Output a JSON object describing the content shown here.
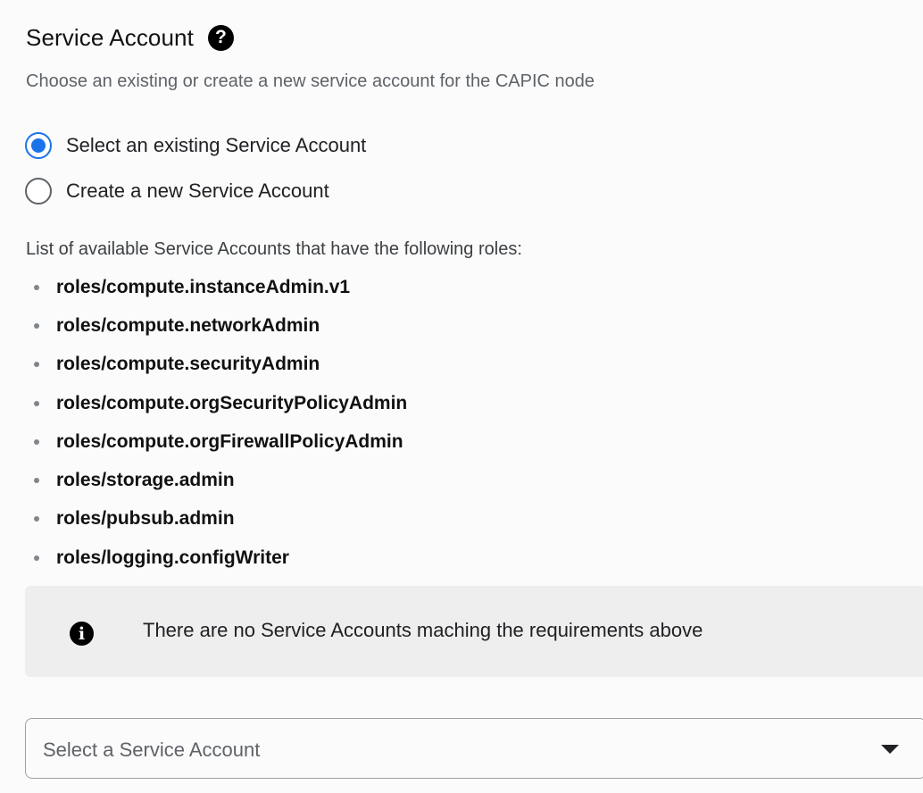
{
  "header": {
    "title": "Service Account",
    "help_icon": "question-circle-icon",
    "subtitle": "Choose an existing or create a new service account for the CAPIC node"
  },
  "options": [
    {
      "label": "Select an existing Service Account",
      "selected": true
    },
    {
      "label": "Create a new Service Account",
      "selected": false
    }
  ],
  "accent_color": "#1a73e8",
  "roles": {
    "intro": "List of available Service Accounts that have the following roles:",
    "items": [
      "roles/compute.instanceAdmin.v1",
      "roles/compute.networkAdmin",
      "roles/compute.securityAdmin",
      "roles/compute.orgSecurityPolicyAdmin",
      "roles/compute.orgFirewallPolicyAdmin",
      "roles/storage.admin",
      "roles/pubsub.admin",
      "roles/logging.configWriter"
    ]
  },
  "info": {
    "icon": "info-icon",
    "message": "There are no Service Accounts maching the requirements above"
  },
  "select": {
    "placeholder": "Select a Service Account",
    "icon": "caret-down-icon"
  }
}
